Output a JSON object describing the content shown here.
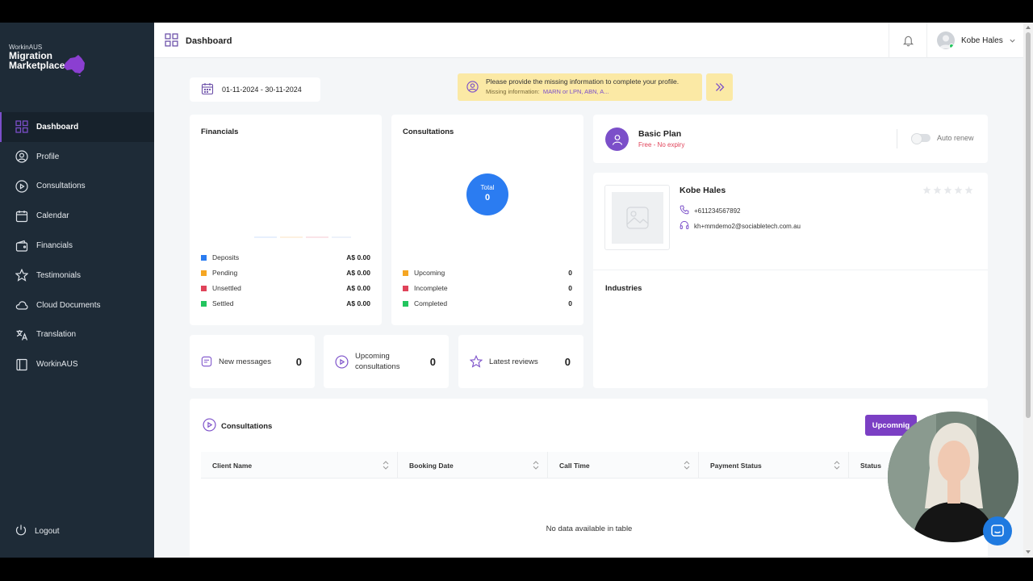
{
  "sidebar": {
    "logo_small": "WorkinAUS",
    "logo_line1": "Migration",
    "logo_line2": "Marketplace",
    "items": [
      {
        "label": "Dashboard"
      },
      {
        "label": "Profile"
      },
      {
        "label": "Consultations"
      },
      {
        "label": "Calendar"
      },
      {
        "label": "Financials"
      },
      {
        "label": "Testimonials"
      },
      {
        "label": "Cloud Documents"
      },
      {
        "label": "Translation"
      },
      {
        "label": "WorkinAUS"
      }
    ],
    "logout": "Logout"
  },
  "topbar": {
    "title": "Dashboard",
    "user_name": "Kobe Hales"
  },
  "date_range": "01-11-2024 - 30-11-2024",
  "alert": {
    "line1": "Please provide the missing information to complete your profile.",
    "line2_prefix": "Missing information:",
    "line2_items": "MARN or LPN, ABN, A..."
  },
  "financials": {
    "title": "Financials",
    "rows": [
      {
        "label": "Deposits",
        "value": "A$ 0.00",
        "color": "#2b7cf1"
      },
      {
        "label": "Pending",
        "value": "A$ 0.00",
        "color": "#f5a623"
      },
      {
        "label": "Unsettled",
        "value": "A$ 0.00",
        "color": "#e0435a"
      },
      {
        "label": "Settled",
        "value": "A$ 0.00",
        "color": "#22c55e"
      }
    ]
  },
  "consultations_card": {
    "title": "Consultations",
    "total_label": "Total",
    "total_value": "0",
    "rows": [
      {
        "label": "Upcoming",
        "value": "0",
        "color": "#f5a623"
      },
      {
        "label": "Incomplete",
        "value": "0",
        "color": "#e0435a"
      },
      {
        "label": "Completed",
        "value": "0",
        "color": "#22c55e"
      }
    ]
  },
  "stats": {
    "messages_label": "New messages",
    "messages_value": "0",
    "upcoming_label_1": "Upcoming",
    "upcoming_label_2": "consultations",
    "upcoming_value": "0",
    "reviews_label": "Latest reviews",
    "reviews_value": "0"
  },
  "plan": {
    "name": "Basic Plan",
    "sub": "Free - No expiry",
    "auto_renew": "Auto renew"
  },
  "profile": {
    "name": "Kobe Hales",
    "phone": "+611234567892",
    "email": "kh+mmdemo2@sociabletech.com.au",
    "industries_title": "Industries"
  },
  "consultations_table": {
    "title": "Consultations",
    "button": "Upcomnig",
    "columns": [
      "Client Name",
      "Booking Date",
      "Call Time",
      "Payment Status",
      "Status"
    ],
    "empty": "No data available in table"
  },
  "colors": {
    "accent": "#7b4fc9",
    "sidebar": "#1e2b37",
    "blue": "#2b7cf1"
  }
}
